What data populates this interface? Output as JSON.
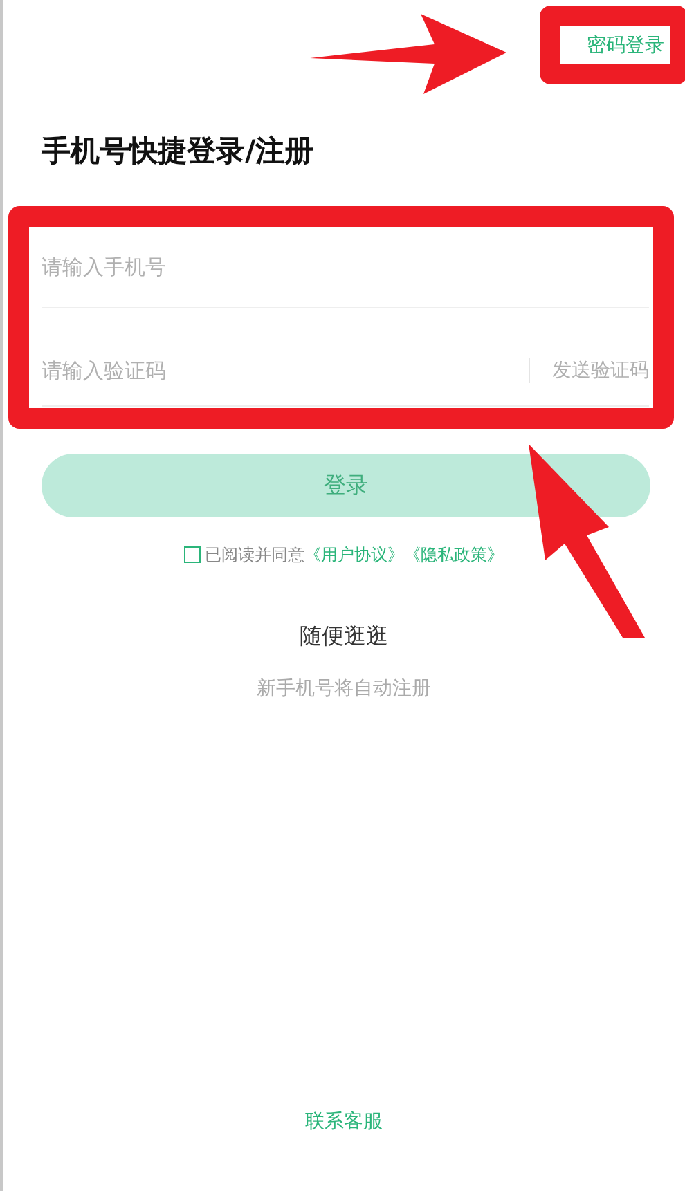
{
  "password_login_link": "密码登录",
  "title": "手机号快捷登录/注册",
  "fields": [
    {
      "kind": "phone",
      "placeholder": "请输入手机号"
    },
    {
      "kind": "code",
      "placeholder": "请输入验证码",
      "action": "发送验证码"
    }
  ],
  "login_button": {
    "label": "登录",
    "disabled": true
  },
  "agreement": {
    "checked": false,
    "text": "已阅读并同意",
    "links": [
      "《用户协议》",
      "《隐私政策》"
    ]
  },
  "browse_link": "随便逛逛",
  "hint": "新手机号将自动注册",
  "contact_link": "联系客服",
  "annotations": [
    {
      "kind": "arrow"
    },
    {
      "kind": "frame"
    },
    {
      "kind": "frame"
    },
    {
      "kind": "arrow"
    }
  ]
}
